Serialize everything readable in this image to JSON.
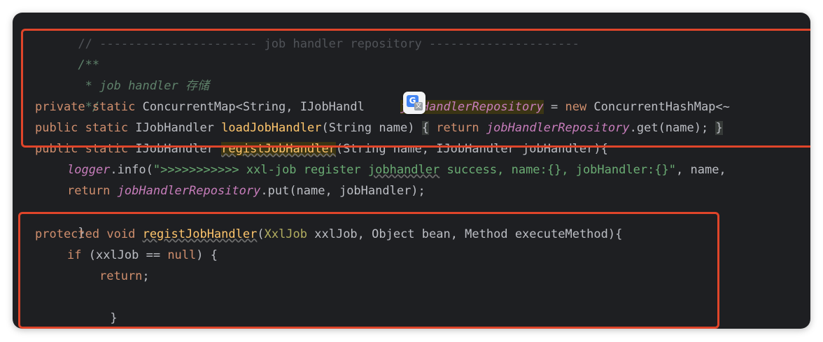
{
  "editor": {
    "lines": {
      "l0": {
        "comment": "// ---------------------- job handler repository ---------------------"
      },
      "l1": {
        "comment": "/**"
      },
      "l2": {
        "comment": " * job handler 存储"
      },
      "l3": {
        "comment": " */"
      },
      "l4": {
        "kw1": "private",
        "kw2": "static",
        "type": "ConcurrentMap<String, IJobHandl",
        "gap": "     ",
        "field": "jobHandlerRepository",
        "eq": " = ",
        "kw3": "new",
        "rest": " ConcurrentHashMap<~"
      },
      "l5": {
        "kw1": "public",
        "kw2": "static",
        "type": " IJobHandler ",
        "fn": "loadJobHandler",
        "args": "(String name) ",
        "brace_open": "{",
        "kw3": "return",
        "field": "jobHandlerRepository",
        "rest": ".get(name); ",
        "brace_close": "}"
      },
      "l6": {
        "kw1": "public",
        "kw2": "static",
        "type": " IJobHandler ",
        "fn": "registJobHandler",
        "rest": "(String name, IJobHandler jobHandler){"
      },
      "l7": {
        "field": "logger",
        "call": ".info(",
        "str1": "\">>>>>>>>>>> xxl-job register ",
        "str_sq": "jobhandler",
        "str2": " success, name:{}, jobHandler:{}\"",
        "rest": ", name,"
      },
      "l8": {
        "kw": "return",
        "field": "jobHandlerRepository",
        "rest": ".put(name, jobHandler);"
      },
      "l9": {
        "brace": "}"
      },
      "l10": {
        "kw1": "protected",
        "kw2": "void",
        "fn": "registJobHandler",
        "paren": "(",
        "ann": "XxlJob",
        "rest": " xxlJob, Object bean, Method executeMethod){"
      },
      "l11": {
        "kw": "if",
        "pre": " (xxlJob == ",
        "kwnull": "null",
        "rest": ") {"
      },
      "l12": {
        "kw": "return",
        "rest": ";"
      },
      "l13": {
        "brace": "}"
      }
    }
  },
  "overlay": {
    "translate_badge": {
      "glyph": "G",
      "sub": "文"
    }
  },
  "colors": {
    "background": "#1e1f22",
    "keyword": "#cf8e6d",
    "comment": "#5f826b",
    "field": "#c77dbb",
    "function": "#56a8f5",
    "string": "#6aab73",
    "highlight_box": "#e0452a"
  }
}
